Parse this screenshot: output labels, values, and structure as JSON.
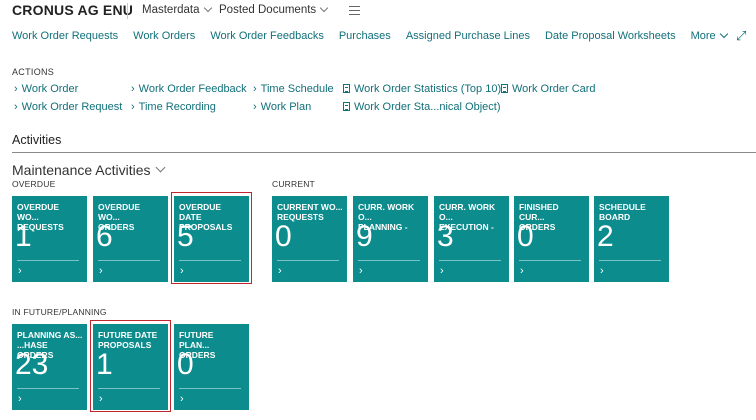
{
  "header": {
    "company": "CRONUS AG ENU",
    "menus": [
      "Masterdata",
      "Posted Documents"
    ]
  },
  "nav": {
    "items": [
      "Work Order Requests",
      "Work Orders",
      "Work Order Feedbacks",
      "Purchases",
      "Assigned Purchase Lines",
      "Date Proposal Worksheets"
    ],
    "more_label": "More"
  },
  "actions": {
    "title": "ACTIONS",
    "col1": [
      "Work Order",
      "Work Order Request"
    ],
    "col2": [
      "Work Order Feedback",
      "Time Recording"
    ],
    "col3": [
      "Time Schedule",
      "Work Plan"
    ],
    "col4": [
      "Work Order Statistics (Top 10)",
      "Work Order Sta...nical Object)"
    ],
    "col5": [
      "Work Order Card"
    ]
  },
  "activities": {
    "title": "Activities",
    "section_title": "Maintenance Activities",
    "groups": {
      "overdue": {
        "label": "OVERDUE",
        "tiles": [
          {
            "title": "OVERDUE WO...\nREQUESTS",
            "value": "1"
          },
          {
            "title": "OVERDUE WO...\nORDERS",
            "value": "6"
          },
          {
            "title": "OVERDUE DATE\nPROPOSALS",
            "value": "5"
          }
        ]
      },
      "current": {
        "label": "CURRENT",
        "tiles": [
          {
            "title": "CURRENT WO...\nREQUESTS",
            "value": "0"
          },
          {
            "title": "CURR. WORK O...\nPLANNING -",
            "value": "9"
          },
          {
            "title": "CURR. WORK O...\nEXECUTION -",
            "value": "3"
          },
          {
            "title": "FINISHED CUR...\nORDERS",
            "value": "0"
          },
          {
            "title": "SCHEDULE\nBOARD",
            "value": "2"
          }
        ]
      },
      "future": {
        "label": "IN FUTURE/PLANNING",
        "tiles": [
          {
            "title": "PLANNING AS...\n...HASE ORDERS",
            "value": "23"
          },
          {
            "title": "FUTURE DATE\nPROPOSALS",
            "value": "1"
          },
          {
            "title": "FUTURE PLAN...\nORDERS",
            "value": "0"
          }
        ]
      }
    },
    "tile_arrow": "›"
  },
  "colors": {
    "tile": "#0d8c8e",
    "link": "#11707a",
    "highlight": "#c0262d"
  }
}
